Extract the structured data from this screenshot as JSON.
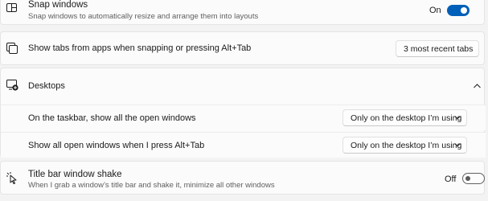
{
  "snap": {
    "title": "Snap windows",
    "description": "Snap windows to automatically resize and arrange them into layouts",
    "toggle_state": "On"
  },
  "tabs": {
    "label": "Show tabs from apps when snapping or pressing Alt+Tab",
    "selected": "3 most recent tabs"
  },
  "desktops": {
    "title": "Desktops",
    "taskbar_label": "On the taskbar, show all the open windows",
    "taskbar_selected": "Only on the desktop I’m using",
    "alttab_label": "Show all open windows when I press Alt+Tab",
    "alttab_selected": "Only on the desktop I’m using"
  },
  "shake": {
    "title": "Title bar window shake",
    "description": "When I grab a window’s title bar and shake it, minimize all other windows",
    "toggle_state": "Off"
  },
  "colors": {
    "accent": "#005fb8",
    "background": "#f3f3f3",
    "card": "#fbfbfb"
  },
  "icons": [
    "snap-layout-icon",
    "tabs-icon",
    "desktops-icon",
    "chevron-up-icon",
    "chevron-down-icon",
    "window-shake-icon"
  ]
}
